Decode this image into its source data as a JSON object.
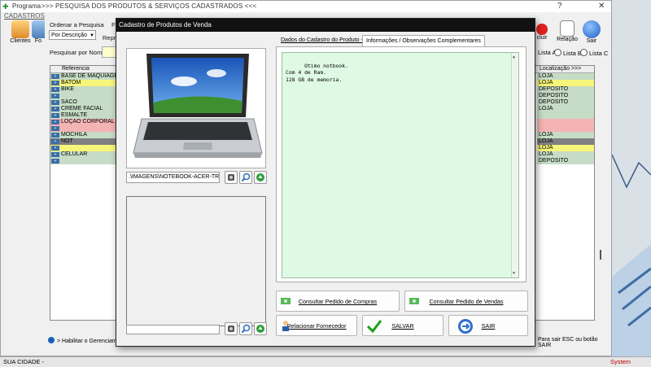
{
  "main_window": {
    "app_title": "Programa",
    "window_title": ">>>  PESQUISA DOS PRODUTOS & SERVIÇOS CADASTRADOS  <<<",
    "menu": "CADASTROS",
    "toolbar": {
      "clientes": "Clientes",
      "fo_partial": "Fo",
      "excluir_partial": "cluir",
      "relacao": "Relação",
      "sair": "Sair"
    },
    "ordenar_label": "Ordenar a Pesquisa",
    "ordenar_value": "Por Descrição",
    "fi_partial": "Fi",
    "repr_partial": "Repre",
    "pesquisar_label": "Pesquisar por Nome",
    "lista_a": "Lista A",
    "lista_b": "Lista B",
    "lista_c": "Lista C",
    "grid": {
      "col_referencia": "Referencia",
      "col_localizacao": "Localização >>>",
      "rows": [
        {
          "name": "BASE DE MAQUIAGE",
          "loc": "LOJA",
          "color": "#c6dcc6"
        },
        {
          "name": "BATOM",
          "loc": "LOJA",
          "color": "#f6f67a"
        },
        {
          "name": "BIKE",
          "loc": "DEPOSITO",
          "color": "#c6dcc6"
        },
        {
          "name": "",
          "loc": "DEPOSITO",
          "color": "#c6dcc6"
        },
        {
          "name": "SACO",
          "loc": "DEPOSITO",
          "color": "#c6dcc6"
        },
        {
          "name": "CREME FACIAL",
          "loc": "LOJA",
          "color": "#c6dcc6"
        },
        {
          "name": "ESMALTE",
          "loc": "",
          "color": "#c6dcc6"
        },
        {
          "name": "LOÇÃO CORPORAL",
          "loc": "",
          "color": "#f4b4b4"
        },
        {
          "name": "",
          "loc": "",
          "color": "#f4b4b4"
        },
        {
          "name": "MOCHILA",
          "loc": "LOJA",
          "color": "#c6dcc6"
        },
        {
          "name": "NOT",
          "loc": "LOJA",
          "color": "#808080"
        },
        {
          "name": "",
          "loc": "LOJA",
          "color": "#f6f67a"
        },
        {
          "name": "CELULAR",
          "loc": "LOJA",
          "color": "#c6dcc6"
        },
        {
          "name": "",
          "loc": "DEPOSITO",
          "color": "#c6dcc6"
        }
      ]
    },
    "habilitar_text": "> Habilitar o Gerenciament",
    "sair_hint": "Para sair ESC ou botão SAIR",
    "status_left": "SUA CIDADE -",
    "status_right": "System"
  },
  "dialog": {
    "title": "Cadastro de Produtos de Venda",
    "image_path": ".\\IMAGENS\\NOTEBOOK-ACER-TRAVI",
    "tabs": {
      "dados": "Dados do Cadastro do Produto ->",
      "info": "Informações / Observações Complementares"
    },
    "notes": "Otimo notbook.\nCom 4 de Ram.\n128 GB de memoria.",
    "buttons": {
      "consultar_compras": "Consultar Pedido de Compras",
      "consultar_vendas": "Consultar Pedido de Vendas",
      "relacionar_fornecedor": "Relacionar Fornecedor",
      "salvar": "SALVAR",
      "sair": "SAIR"
    }
  }
}
